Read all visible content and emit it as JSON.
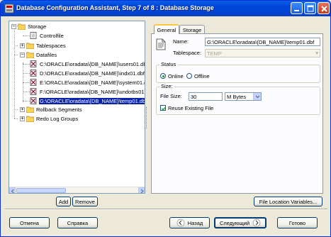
{
  "window": {
    "title": "Database Configuration Assistant, Step 7 of 8 : Database Storage"
  },
  "tree": {
    "root": "Storage",
    "controlfile": "Controlfile",
    "tablespaces": "Tablespaces",
    "datafiles": "Datafiles",
    "files": [
      "C:\\ORACLE\\oradata\\{DB_NAME}\\users01.db",
      "D:\\ORACLE\\oradata\\{DB_NAME}\\indx01.dbf",
      "E:\\ORACLE\\oradata\\{DB_NAME}\\system01.d",
      "F:\\ORACLE\\oradata\\{DB_NAME}\\undotbs01",
      "G:\\ORACLE\\oradata\\{DB_NAME}\\temp01.dbf"
    ],
    "selected_index": 4,
    "rollback_segments": "Rollback Segments",
    "redo_log_groups": "Redo Log Groups"
  },
  "tree_buttons": {
    "add": "Add",
    "remove": "Remove"
  },
  "tabs": [
    {
      "label": "General",
      "active": true
    },
    {
      "label": "Storage",
      "active": false
    }
  ],
  "general": {
    "name_label": "Name:",
    "name_value": "G:\\ORACLE\\oradata\\{DB_NAME}\\temp01.dbf",
    "tablespace_label": "Tablespace:",
    "tablespace_value": "TEMP",
    "status_group": "Status",
    "online_label": "Online",
    "offline_label": "Offline",
    "status_selected": "Online",
    "size_group": "Size:",
    "file_size_label": "File Size:",
    "file_size_value": "30",
    "unit_value": "M Bytes",
    "reuse_label": "Reuse Existing File",
    "reuse_checked": true
  },
  "file_location_button": "File Location Variables...",
  "footer": {
    "cancel": "Отмена",
    "help": "Справка",
    "back": "Назад",
    "next": "Следующий",
    "finish": "Готово"
  },
  "colors": {
    "titlebar": "#0042D6",
    "selection": "#0A24A8",
    "tab_highlight": "#FFC83C",
    "window_bg": "#ECE9D8"
  }
}
